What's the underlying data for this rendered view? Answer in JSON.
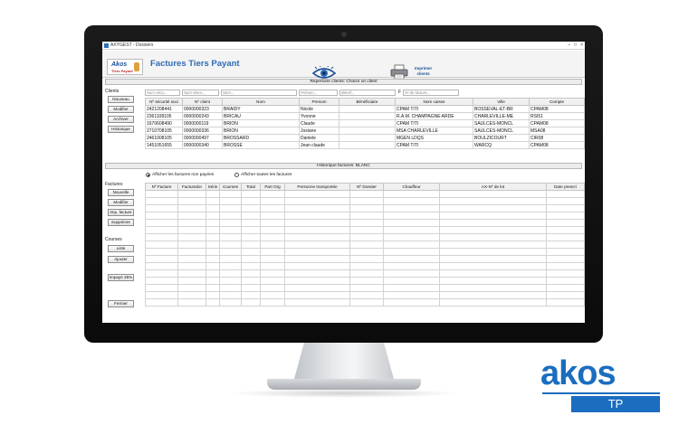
{
  "window": {
    "title": "AXYGEST - Dossiers",
    "controls": [
      "–",
      "□",
      "×"
    ]
  },
  "header": {
    "logo_top": "Akos",
    "logo_bottom": "Tiers Payant",
    "app_title": "Factures Tiers Payant",
    "view_icon": "eye-icon",
    "print_icon": "printer-icon",
    "print_label_line1": "Imprimer",
    "print_label_line2": "clients"
  },
  "clients_section": {
    "bar_title": "Repertoire clients: Choisir un client",
    "group_label": "Clients",
    "buttons": [
      "Nouveau",
      "Modifier",
      "Archiver",
      "Historique"
    ],
    "filter_f_label": "F",
    "filters": [
      "Num sécu...",
      "Num client...",
      "Nom...",
      "Prénom...",
      "Bénéf...",
      "Nº de facture..."
    ],
    "columns": [
      "Nº sécurité soci",
      "Nº client",
      "Nom",
      "Prenom",
      "Bénéficiaire",
      "Nom caisse",
      "Ville",
      "Compte"
    ],
    "rows": [
      [
        "2421208441",
        "0000000323",
        "BRAIDY",
        "Nicole",
        "",
        "CPAM TITI",
        "BOSSEVAL-ET-BR",
        "CPAM08"
      ],
      [
        "2361108105",
        "0000000243",
        "BRICAU",
        "Yvonne",
        "",
        "R.A.M. CHAMPAGNE ARDE",
        "CHARLEVILLE-ME",
        "RSI51"
      ],
      [
        "1670608490",
        "0000000119",
        "BRION",
        "Claude",
        "",
        "CPAM TITI",
        "SAULCES-MONCL",
        "CPAM08"
      ],
      [
        "2710708105",
        "0000000336",
        "BRION",
        "Josiane",
        "",
        "MSA CHARLEVILLE",
        "SAULCES-MONCL",
        "MSA08"
      ],
      [
        "2461008105",
        "0000000497",
        "BROSSARD",
        "Daniele",
        "",
        "MGEN LDQS",
        "BOULZICOURT",
        "CIR08"
      ],
      [
        "1451051655",
        "0000000340",
        "BROSSE",
        "Jean claude",
        "",
        "CPAM TITI",
        "WARCQ",
        "CPAM08"
      ]
    ]
  },
  "history_section": {
    "bar_title": "Historique factures: BLANC",
    "radio_unpaid": "Afficher les factures non payées",
    "radio_all": "Afficher toutes les factures",
    "factures_label": "Factures",
    "factures_buttons": [
      "Nouvelle",
      "Modifier",
      "Imp. facture",
      "Supprimer"
    ],
    "courses_label": "Courses",
    "courses_buttons": [
      "Liste",
      "Ajouter"
    ],
    "impaye_button": "Impayé 35%",
    "close_button": "Fermer",
    "columns": [
      "Nº Facture",
      "Facturatior",
      "Série",
      "Courses",
      "Total",
      "Part Org",
      "Personne transportée",
      "Nº Dossier",
      "Chauffeur",
      "AX-Nº de lot",
      "Date prescri"
    ]
  },
  "brand": {
    "word": "akos",
    "badge": "TP"
  }
}
